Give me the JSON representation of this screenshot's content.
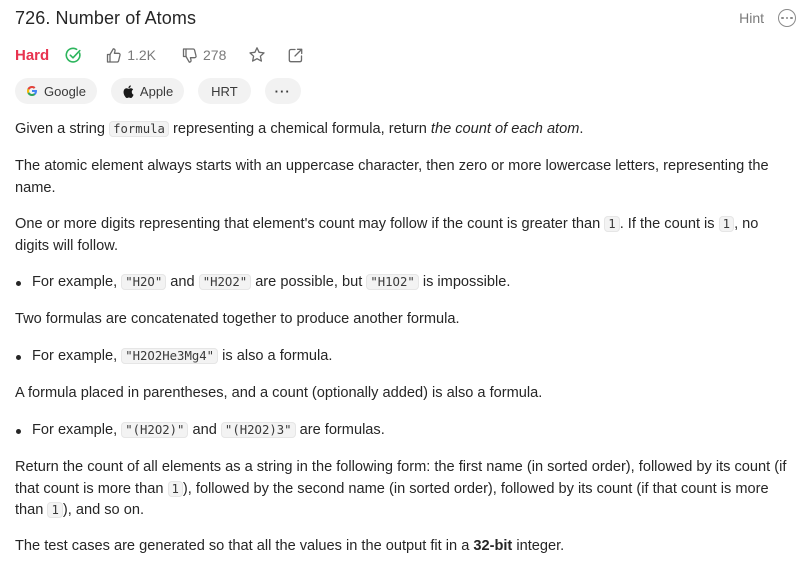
{
  "header": {
    "title": "726. Number of Atoms",
    "hint_label": "Hint"
  },
  "meta": {
    "difficulty": "Hard",
    "likes": "1.2K",
    "dislikes": "278"
  },
  "tags": [
    {
      "label": "Google",
      "icon": "google-icon"
    },
    {
      "label": "Apple",
      "icon": "apple-icon"
    },
    {
      "label": "HRT"
    },
    {
      "label": "···"
    }
  ],
  "colors": {
    "difficulty_hard": "#e8334f",
    "solved_green": "#2db55d"
  },
  "description": {
    "p1": {
      "a": "Given a string ",
      "code": "formula",
      "b": " representing a chemical formula, return ",
      "em": "the count of each atom",
      "c": "."
    },
    "p2": "The atomic element always starts with an uppercase character, then zero or more lowercase letters, representing the name.",
    "p3": {
      "a": "One or more digits representing that element's count may follow if the count is greater than ",
      "code1": "1",
      "b": ". If the count is ",
      "code2": "1",
      "c": ", no digits will follow."
    },
    "b1": {
      "a": "For example, ",
      "code1": "\"H2O\"",
      "b": " and ",
      "code2": "\"H2O2\"",
      "c": " are possible, but ",
      "code3": "\"H1O2\"",
      "d": " is impossible."
    },
    "p4": "Two formulas are concatenated together to produce another formula.",
    "b2": {
      "a": "For example, ",
      "code1": "\"H2O2He3Mg4\"",
      "b": " is also a formula."
    },
    "p5": "A formula placed in parentheses, and a count (optionally added) is also a formula.",
    "b3": {
      "a": "For example, ",
      "code1": "\"(H2O2)\"",
      "b": " and ",
      "code2": "\"(H2O2)3\"",
      "c": " are formulas."
    },
    "p6": {
      "a": "Return the count of all elements as a string in the following form: the first name (in sorted order), followed by its count (if that count is more than ",
      "code1": "1",
      "b": "), followed by the second name (in sorted order), followed by its count (if that count is more than ",
      "code2": "1",
      "c": "), and so on."
    },
    "p7": {
      "a": "The test cases are generated so that all the values in the output fit in a ",
      "bold": "32-bit",
      "b": " integer."
    }
  }
}
